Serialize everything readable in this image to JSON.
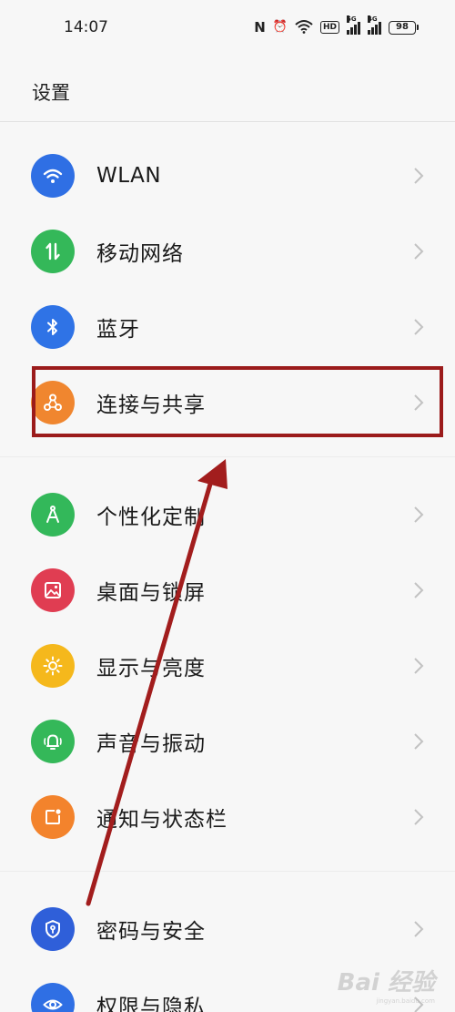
{
  "status_bar": {
    "time": "14:07",
    "nfc_glyph": "N",
    "alarm_glyph": "⏰",
    "hd_label": "HD",
    "network_1": "5G",
    "network_2": "4G",
    "battery": "98"
  },
  "page": {
    "title": "设置"
  },
  "settings": [
    {
      "label": "WLAN",
      "icon": "wifi-icon",
      "color": "#2f6fe4"
    },
    {
      "label": "移动网络",
      "icon": "mobile-data-icon",
      "color": "#34b859"
    },
    {
      "label": "蓝牙",
      "icon": "bluetooth-icon",
      "color": "#2f73e6"
    },
    {
      "label": "连接与共享",
      "icon": "connection-share-icon",
      "color": "#f0862f"
    },
    {
      "label": "个性化定制",
      "icon": "personalization-icon",
      "color": "#33b85a"
    },
    {
      "label": "桌面与锁屏",
      "icon": "wallpaper-icon",
      "color": "#e03d52"
    },
    {
      "label": "显示与亮度",
      "icon": "brightness-icon",
      "color": "#f5b81c"
    },
    {
      "label": "声音与振动",
      "icon": "bell-vibrate-icon",
      "color": "#34b859"
    },
    {
      "label": "通知与状态栏",
      "icon": "notification-icon",
      "color": "#f3832c"
    },
    {
      "label": "密码与安全",
      "icon": "shield-key-icon",
      "color": "#2f5fd9"
    },
    {
      "label": "权限与隐私",
      "icon": "privacy-eye-icon",
      "color": "#2f6fe4"
    }
  ],
  "watermark": {
    "main": "Bai 经验",
    "sub": "jingyan.baidu.com"
  }
}
